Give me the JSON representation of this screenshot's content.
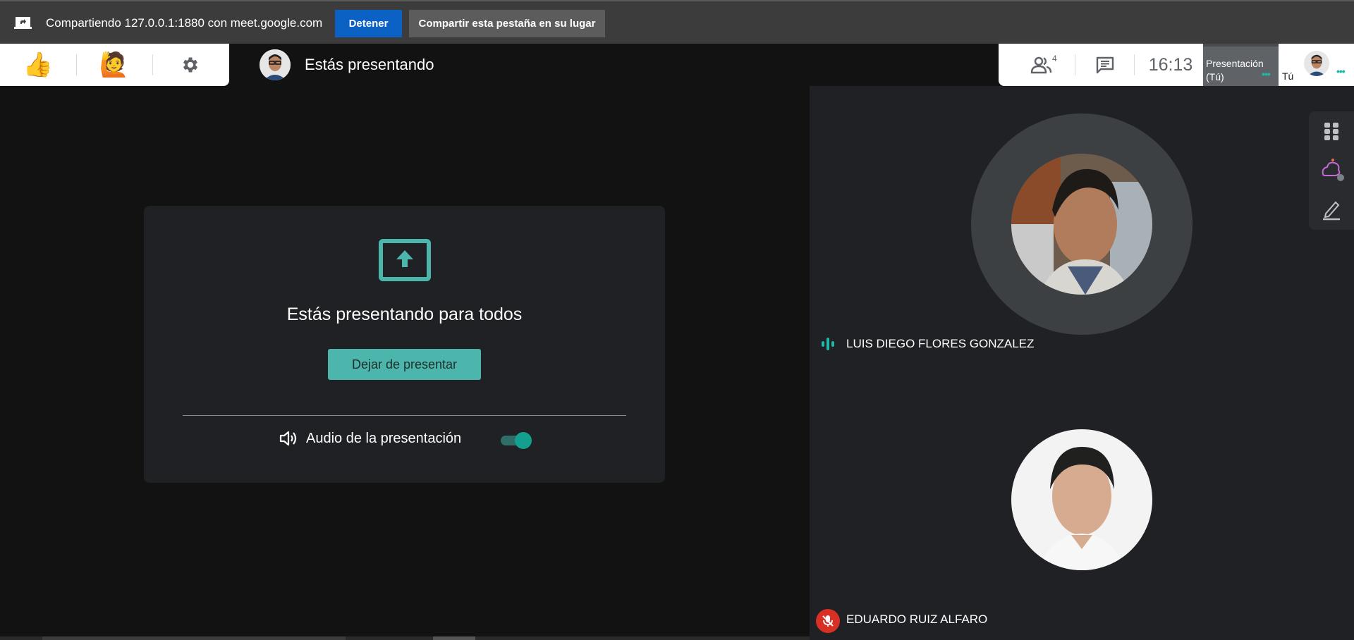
{
  "share_bar": {
    "text": "Compartiendo 127.0.0.1:1880 con meet.google.com",
    "stop_label": "Detener",
    "share_tab_label": "Compartir esta pestaña en su lugar"
  },
  "reactions": {
    "thumbs_up": "👍",
    "raise_hand": "🙋"
  },
  "header": {
    "title": "Estás presentando"
  },
  "toolbar": {
    "people_count": "4",
    "clock": "16:13"
  },
  "thumbnails": {
    "presentation_label_line1": "Presentación",
    "presentation_label_line2": "(Tú)",
    "you_label": "Tú"
  },
  "main": {
    "heading": "Estás presentando para todos",
    "stop_presenting_label": "Dejar de presentar",
    "audio_label": "Audio de la presentación",
    "audio_enabled": true
  },
  "participants": [
    {
      "name": "LUIS DIEGO FLORES GONZALEZ",
      "status": "speaking"
    },
    {
      "name": "EDUARDO RUIZ ALFARO",
      "status": "muted"
    }
  ],
  "colors": {
    "accent_teal": "#4db6ac",
    "stop_blue": "#0b62c4",
    "muted_red": "#d93025"
  }
}
